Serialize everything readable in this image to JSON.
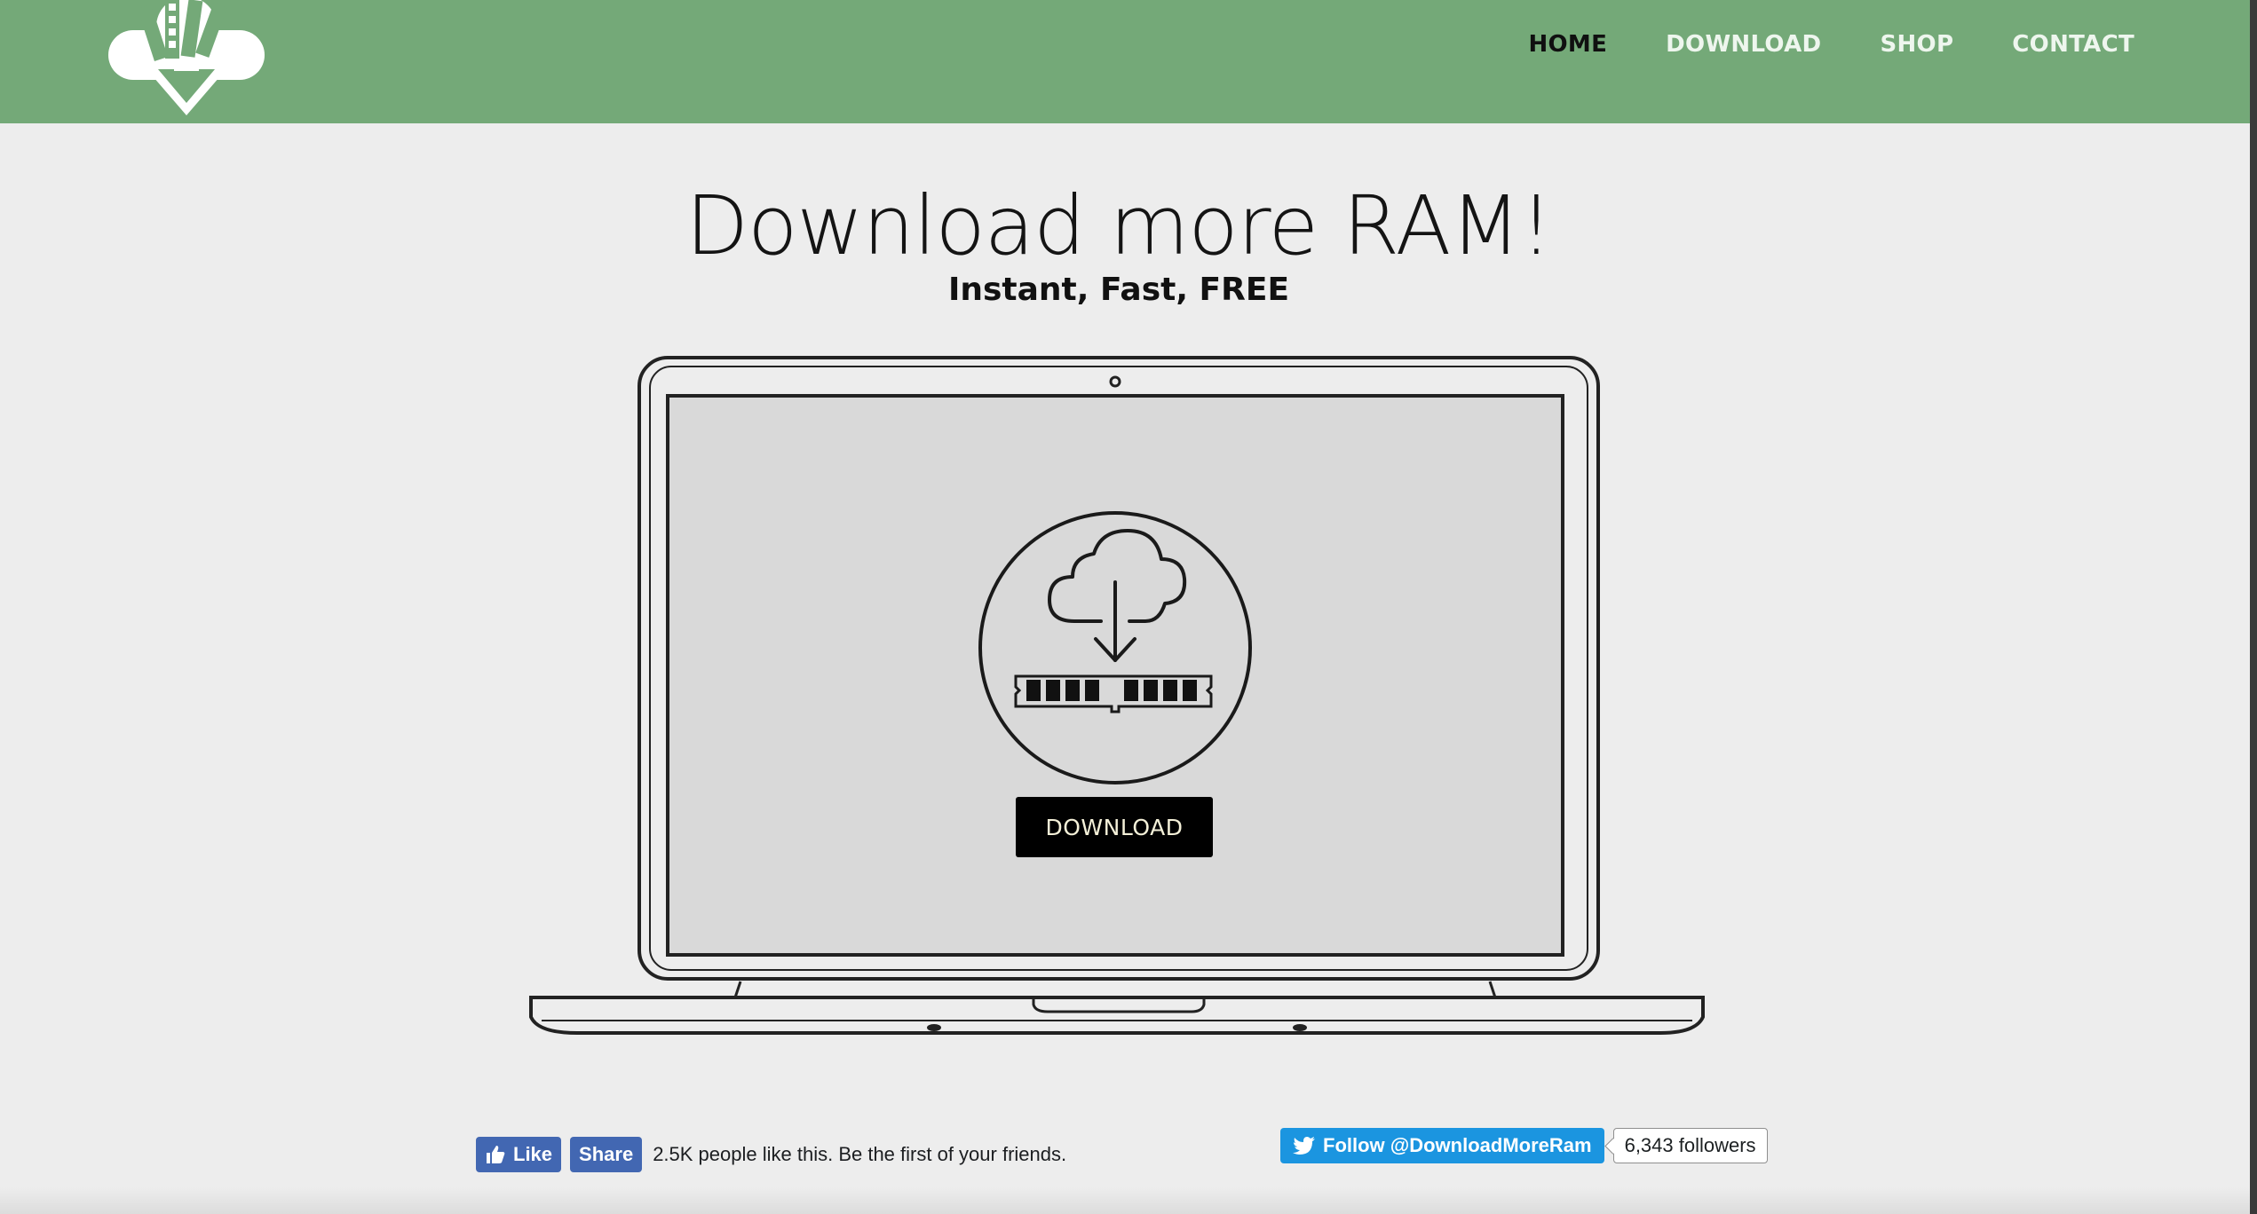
{
  "nav": {
    "items": [
      {
        "label": "HOME",
        "active": true
      },
      {
        "label": "DOWNLOAD",
        "active": false
      },
      {
        "label": "SHOP",
        "active": false
      },
      {
        "label": "CONTACT",
        "active": false
      }
    ]
  },
  "hero": {
    "title": "Download more RAM!",
    "subtitle": "Instant, Fast, FREE",
    "download_button": "DOWNLOAD"
  },
  "facebook": {
    "like_label": "Like",
    "share_label": "Share",
    "text": "2.5K people like this. Be the first of your friends."
  },
  "twitter": {
    "follow_label": "Follow @DownloadMoreRam",
    "followers": "6,343 followers"
  },
  "colors": {
    "header_bg": "#74a978",
    "page_bg": "#ededed",
    "screen_bg": "#d9d9d9",
    "facebook_blue": "#4267b2",
    "twitter_blue": "#1b95e0"
  },
  "icons": [
    "logo-cloud-ram-icon",
    "cloud-download-icon",
    "ram-stick-icon",
    "thumbs-up-icon",
    "twitter-bird-icon"
  ]
}
